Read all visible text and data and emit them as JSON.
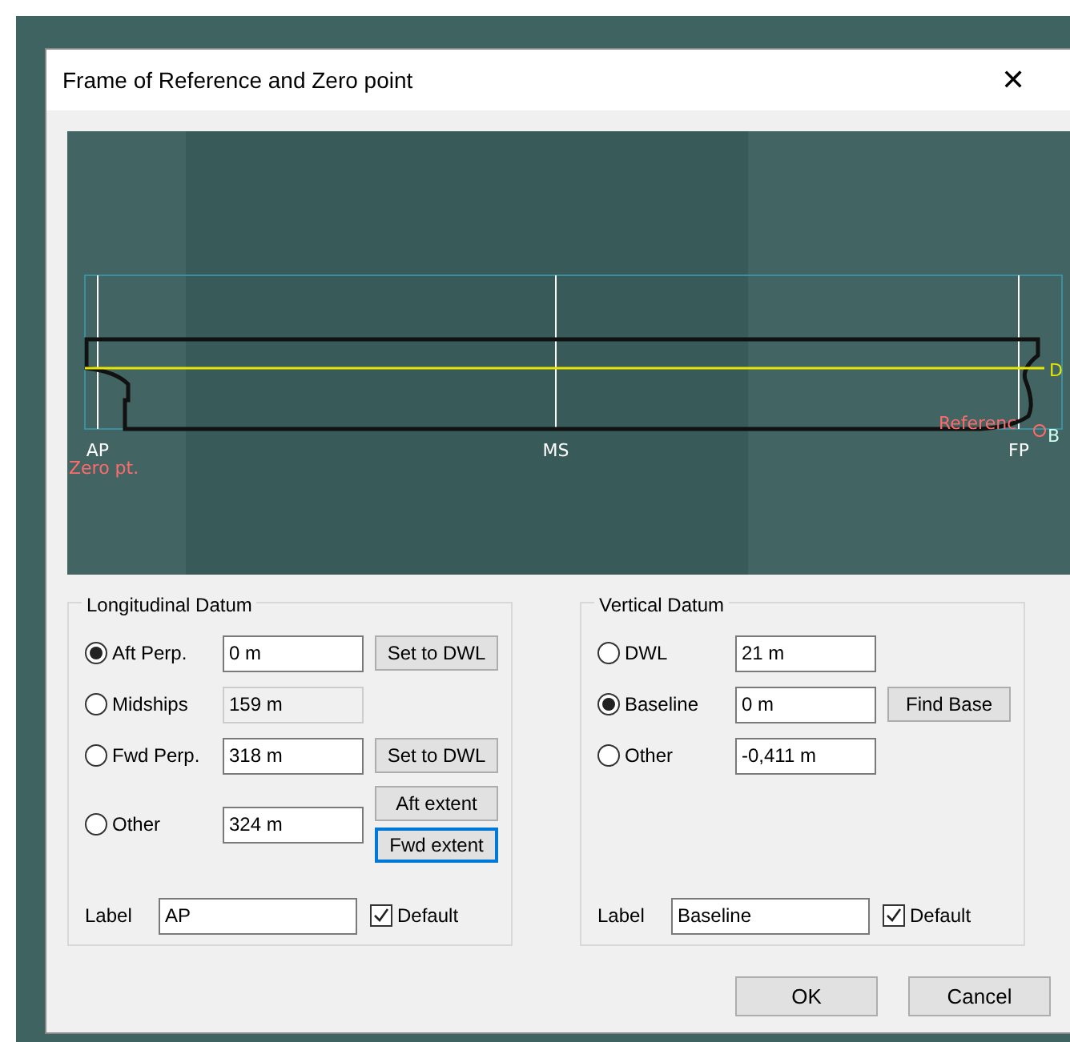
{
  "window": {
    "title": "Frame of Reference and Zero point",
    "close": "✕"
  },
  "diagram": {
    "labels": [
      {
        "text": "AP",
        "kind": "station"
      },
      {
        "text": "MS",
        "kind": "station"
      },
      {
        "text": "FP",
        "kind": "station"
      },
      {
        "text": "Zero pt.",
        "kind": "zero"
      },
      {
        "text": "Referenc",
        "kind": "reference"
      },
      {
        "text": "D",
        "kind": "waterline"
      },
      {
        "text": "B",
        "kind": "base"
      }
    ]
  },
  "longitudinal_datum": {
    "title": "Longitudinal Datum",
    "options": [
      {
        "label": "Aft Perp.",
        "selected": true,
        "value": "0 m",
        "disabled": false,
        "buttons": [
          {
            "label": "Set to DWL",
            "focused": false
          }
        ]
      },
      {
        "label": "Midships",
        "selected": false,
        "value": "159 m",
        "disabled": true
      },
      {
        "label": "Fwd Perp.",
        "selected": false,
        "value": "318 m",
        "disabled": false,
        "buttons": [
          {
            "label": "Set to DWL",
            "focused": false
          }
        ]
      },
      {
        "label": "Other",
        "selected": false,
        "value": "324 m",
        "disabled": false,
        "buttons": [
          {
            "label": "Aft extent",
            "focused": false
          },
          {
            "label": "Fwd extent",
            "focused": true
          }
        ]
      }
    ],
    "label_field": {
      "label": "Label",
      "value": "AP"
    },
    "default": {
      "label": "Default",
      "checked": true
    }
  },
  "vertical_datum": {
    "title": "Vertical Datum",
    "options": [
      {
        "label": "DWL",
        "selected": false,
        "value": "21 m",
        "disabled": false
      },
      {
        "label": "Baseline",
        "selected": true,
        "value": "0 m",
        "disabled": false,
        "buttons": [
          {
            "label": "Find Base",
            "focused": false
          }
        ]
      },
      {
        "label": "Other",
        "selected": false,
        "value": "-0,411 m",
        "disabled": false
      }
    ],
    "label_field": {
      "label": "Label",
      "value": "Baseline"
    },
    "default": {
      "label": "Default",
      "checked": true
    }
  },
  "buttons": [
    {
      "label": "OK",
      "focused": false
    },
    {
      "label": "Cancel",
      "focused": false
    }
  ]
}
